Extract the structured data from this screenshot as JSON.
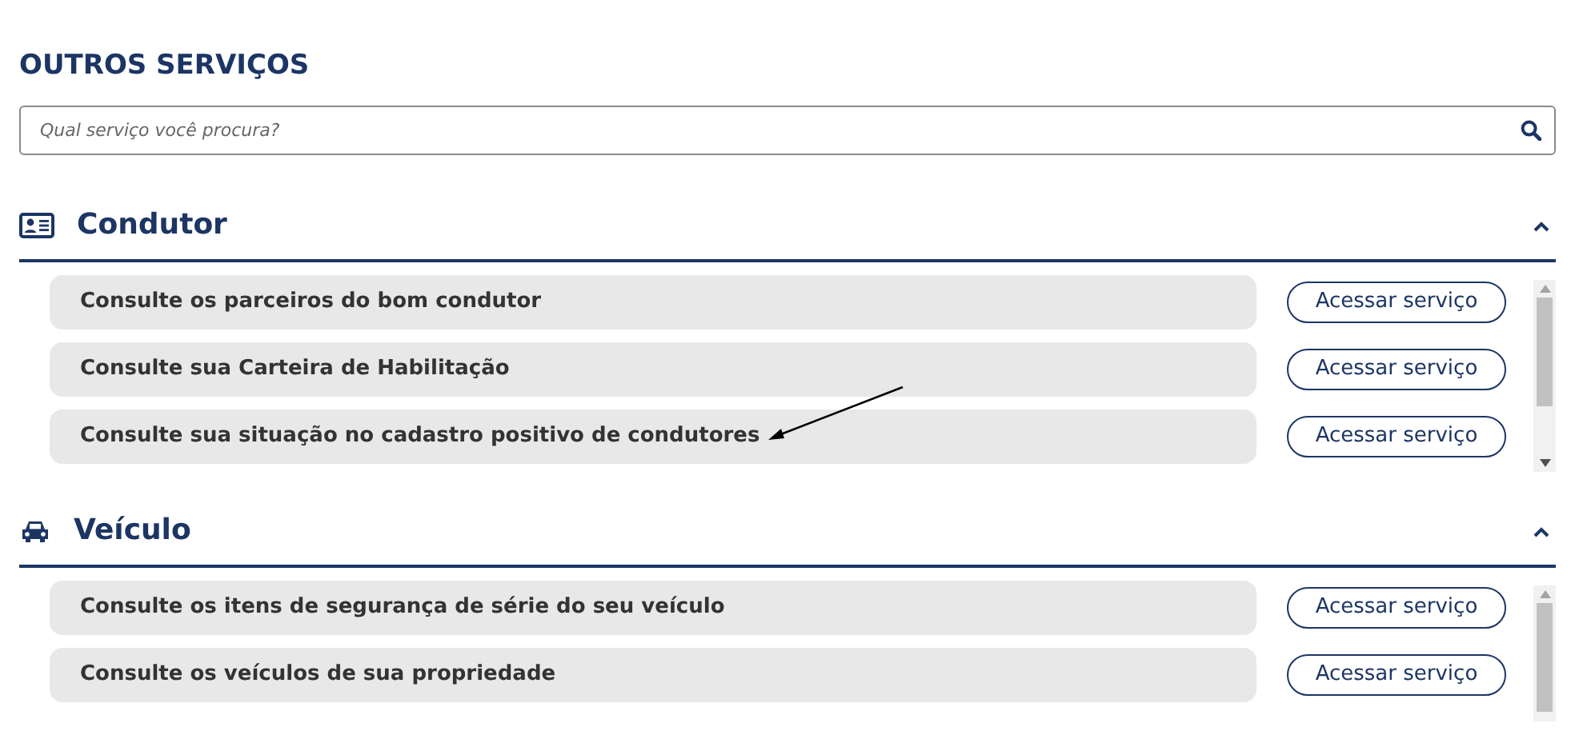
{
  "title": "OUTROS SERVIÇOS",
  "search": {
    "placeholder": "Qual serviço você procura?"
  },
  "sections": [
    {
      "kind": "driver",
      "title": "Condutor",
      "expanded": true,
      "items": [
        {
          "label": "Consulte os parceiros do bom condutor",
          "button": "Acessar serviço"
        },
        {
          "label": "Consulte sua Carteira de Habilitação",
          "button": "Acessar serviço"
        },
        {
          "label": "Consulte sua situação no cadastro positivo de condutores",
          "button": "Acessar serviço"
        }
      ]
    },
    {
      "kind": "vehicle",
      "title": "Veículo",
      "expanded": true,
      "items": [
        {
          "label": "Consulte os itens de segurança de série do seu veículo",
          "button": "Acessar serviço"
        },
        {
          "label": "Consulte os veículos de sua propriedade",
          "button": "Acessar serviço"
        }
      ]
    }
  ]
}
